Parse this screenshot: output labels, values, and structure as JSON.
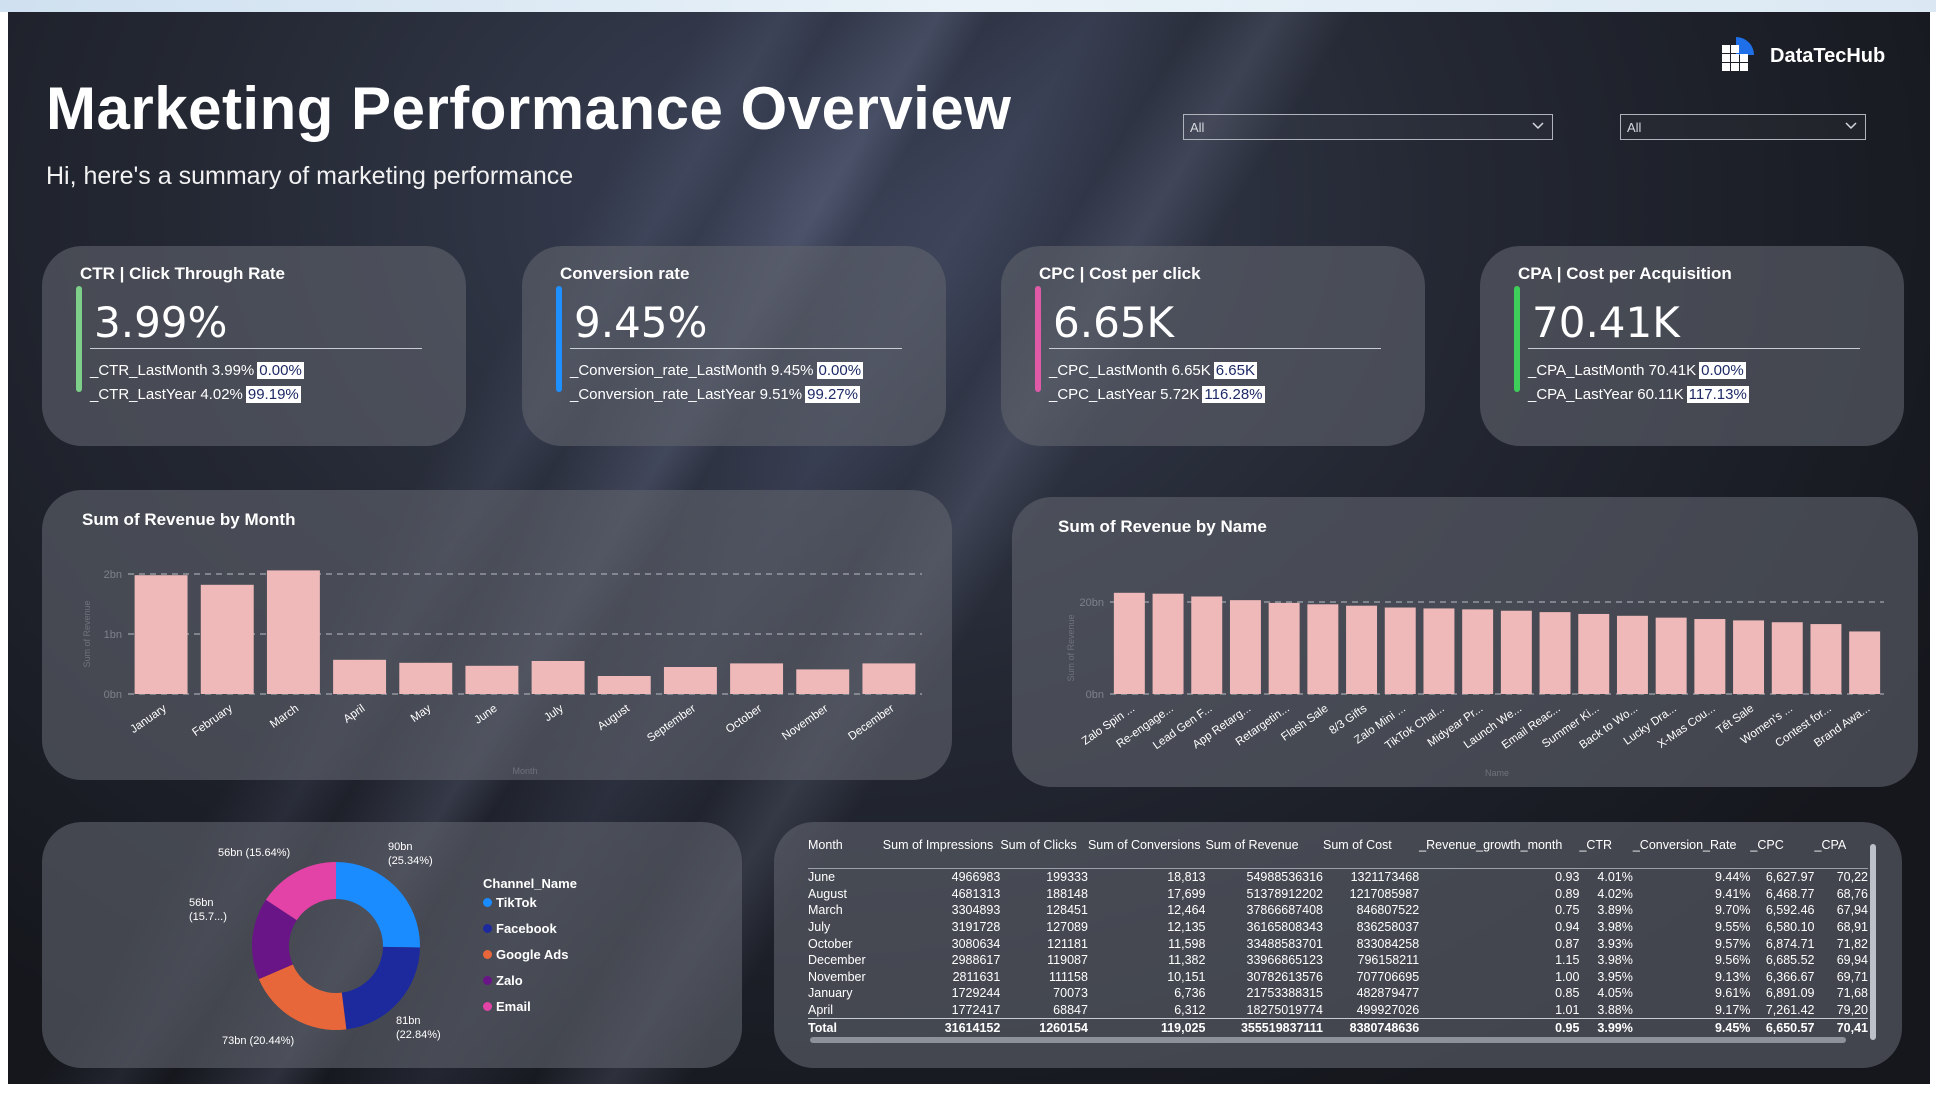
{
  "header": {
    "title": "Marketing Performance Overview",
    "subtitle": "Hi, here's a summary of marketing performance",
    "logo_text": "DataTecHub",
    "slicer1_value": "All",
    "slicer2_value": "All"
  },
  "kpis": [
    {
      "title": "CTR | Click Through Rate",
      "value": "3.99%",
      "accent": "#7ecf8a",
      "line1": "_CTR_LastMonth 3.99%",
      "line1_pct": "0.00%",
      "line2": "_CTR_LastYear 4.02%",
      "line2_pct": "99.19%"
    },
    {
      "title": "Conversion rate",
      "value": "9.45%",
      "accent": "#1e90ff",
      "line1": "_Conversion_rate_LastMonth 9.45%",
      "line1_pct": "0.00%",
      "line2": "_Conversion_rate_LastYear 9.51%",
      "line2_pct": "99.27%"
    },
    {
      "title": "CPC | Cost per click",
      "value": "6.65K",
      "accent": "#e05aa8",
      "line1": "_CPC_LastMonth 6.65K",
      "line1_pct": "6.65K",
      "line2": "_CPC_LastYear 5.72K",
      "line2_pct": "116.28%"
    },
    {
      "title": "CPA | Cost per Acquisition",
      "value": "70.41K",
      "accent": "#3ecf5a",
      "line1": "_CPA_LastMonth 70.41K",
      "line1_pct": "0.00%",
      "line2": "_CPA_LastYear 60.11K",
      "line2_pct": "117.13%"
    }
  ],
  "revenue_month_panel": {
    "title": "Sum of Revenue by Month"
  },
  "revenue_name_panel": {
    "title": "Sum of Revenue by Name"
  },
  "chart_data": [
    {
      "type": "bar",
      "title": "Sum of Revenue by Month",
      "xlabel": "Month",
      "ylabel": "Sum of Revenue",
      "ylim": [
        0,
        2
      ],
      "y_ticks": [
        "0bn",
        "1bn",
        "2bn"
      ],
      "grid": true,
      "categories": [
        "January",
        "February",
        "March",
        "April",
        "May",
        "June",
        "July",
        "August",
        "September",
        "October",
        "November",
        "December"
      ],
      "values": [
        1.98,
        1.82,
        2.06,
        0.57,
        0.52,
        0.47,
        0.55,
        0.3,
        0.45,
        0.51,
        0.41,
        0.51
      ],
      "color": "#efb9b9"
    },
    {
      "type": "bar",
      "title": "Sum of Revenue by Name",
      "xlabel": "Name",
      "ylabel": "Sum of Revenue",
      "ylim": [
        0,
        20
      ],
      "y_ticks": [
        "0bn",
        "20bn"
      ],
      "grid": true,
      "categories": [
        "Zalo Spin ...",
        "Re-engage...",
        "Lead Gen F...",
        "App Retarg...",
        "Retargetin...",
        "Flash Sale",
        "8/3 Gifts",
        "Zalo Mini ...",
        "TikTok Chal...",
        "Midyear Pr...",
        "Launch We...",
        "Email Reac...",
        "Summer Ki...",
        "Back to Wo...",
        "Lucky Dra...",
        "X-Mas Cou...",
        "Tết Sale",
        "Women's ...",
        "Contest for...",
        "Brand Awa..."
      ],
      "values": [
        22.0,
        21.8,
        21.2,
        20.4,
        19.8,
        19.5,
        19.2,
        18.8,
        18.6,
        18.4,
        18.1,
        17.8,
        17.4,
        17.0,
        16.6,
        16.3,
        16.0,
        15.6,
        15.2,
        13.6
      ],
      "color": "#efb9b9"
    },
    {
      "type": "pie",
      "title": "",
      "legend_title": "Channel_Name",
      "legend_position": "right",
      "slices": [
        {
          "name": "TikTok",
          "value": 90,
          "label": "90bn",
          "pct_label": "(25.34%)",
          "color": "#1a8cff"
        },
        {
          "name": "Facebook",
          "value": 81,
          "label": "81bn",
          "pct_label": "(22.84%)",
          "color": "#1d2a9e"
        },
        {
          "name": "Google Ads",
          "value": 73,
          "label": "73bn (20.44%)",
          "pct_label": "",
          "color": "#e8673a"
        },
        {
          "name": "Zalo",
          "value": 56,
          "label": "56bn",
          "pct_label": "(15.7...)",
          "color": "#6a1587"
        },
        {
          "name": "Email",
          "value": 56,
          "label": "56bn (15.64%)",
          "pct_label": "",
          "color": "#e342a7"
        }
      ]
    }
  ],
  "table": {
    "columns": [
      "Month",
      "Sum of Impressions",
      "Sum of Clicks",
      "Sum of Conversions",
      "Sum of Revenue",
      "Sum of Cost",
      "_Revenue_growth_month",
      "_CTR",
      "_Conversion_Rate",
      "_CPC",
      "_CPA"
    ],
    "rows": [
      [
        "June",
        "4966983",
        "199333",
        "18,813",
        "54988536316",
        "1321173468",
        "0.93",
        "4.01%",
        "9.44%",
        "6,627.97",
        "70,22"
      ],
      [
        "August",
        "4681313",
        "188148",
        "17,699",
        "51378912202",
        "1217085987",
        "0.89",
        "4.02%",
        "9.41%",
        "6,468.77",
        "68,76"
      ],
      [
        "March",
        "3304893",
        "128451",
        "12,464",
        "37866687408",
        "846807522",
        "0.75",
        "3.89%",
        "9.70%",
        "6,592.46",
        "67,94"
      ],
      [
        "July",
        "3191728",
        "127089",
        "12,135",
        "36165808343",
        "836258037",
        "0.94",
        "3.98%",
        "9.55%",
        "6,580.10",
        "68,91"
      ],
      [
        "October",
        "3080634",
        "121181",
        "11,598",
        "33488583701",
        "833084258",
        "0.87",
        "3.93%",
        "9.57%",
        "6,874.71",
        "71,82"
      ],
      [
        "December",
        "2988617",
        "119087",
        "11,382",
        "33966865123",
        "796158211",
        "1.15",
        "3.98%",
        "9.56%",
        "6,685.52",
        "69,94"
      ],
      [
        "November",
        "2811631",
        "111158",
        "10,151",
        "30782613576",
        "707706695",
        "1.00",
        "3.95%",
        "9.13%",
        "6,366.67",
        "69,71"
      ],
      [
        "January",
        "1729244",
        "70073",
        "6,736",
        "21753388315",
        "482879477",
        "0.85",
        "4.05%",
        "9.61%",
        "6,891.09",
        "71,68"
      ],
      [
        "April",
        "1772417",
        "68847",
        "6,312",
        "18275019774",
        "499927026",
        "1.01",
        "3.88%",
        "9.17%",
        "7,261.42",
        "79,20"
      ]
    ],
    "total": [
      "Total",
      "31614152",
      "1260154",
      "119,025",
      "355519837111",
      "8380748636",
      "0.95",
      "3.99%",
      "9.45%",
      "6,650.57",
      "70,41"
    ]
  }
}
